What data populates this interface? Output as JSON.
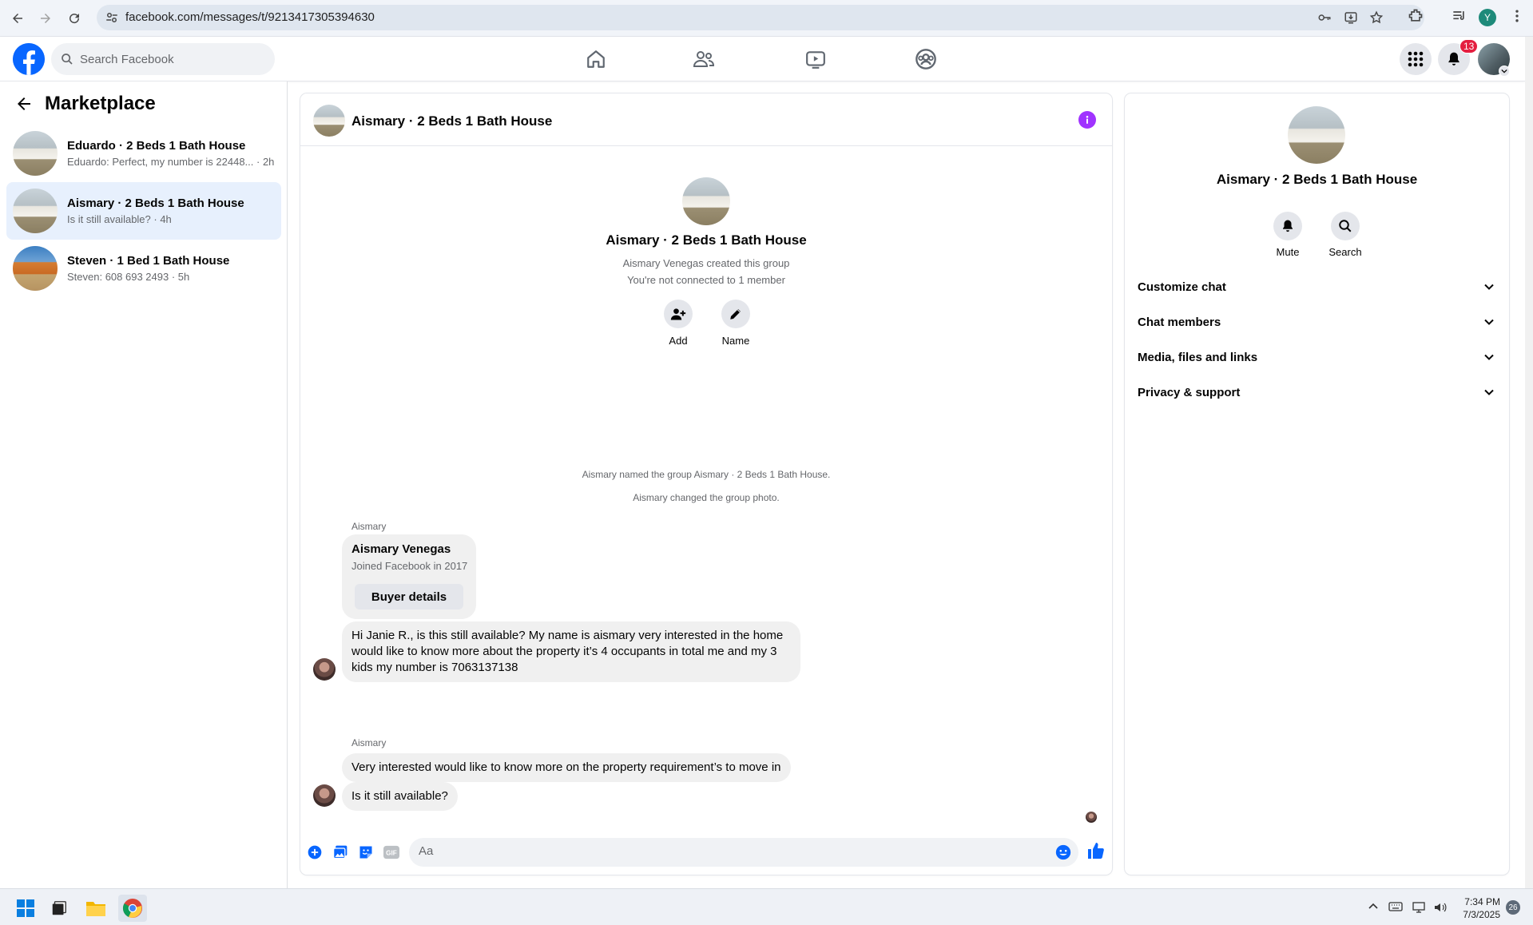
{
  "browser": {
    "url": "facebook.com/messages/t/9213417305394630",
    "profile_initial": "Y"
  },
  "fbnav": {
    "search_placeholder": "Search Facebook",
    "tabs": [
      "home-icon",
      "friends-icon",
      "video-icon",
      "groups-icon"
    ],
    "notification_count": "13"
  },
  "sidebar": {
    "title": "Marketplace",
    "conversations": [
      {
        "title": "Eduardo · 2 Beds 1 Bath House",
        "preview": "Eduardo: Perfect, my number is 22448... · 2h",
        "active": false
      },
      {
        "title": "Aismary · 2 Beds 1 Bath House",
        "preview": "Is it still available? · 4h",
        "active": true
      },
      {
        "title": "Steven · 1 Bed 1 Bath House",
        "preview": "Steven: 608 693 2493 · 5h",
        "active": false
      }
    ]
  },
  "chat": {
    "header_title": "Aismary · 2 Beds 1 Bath House",
    "group_name": "Aismary · 2 Beds 1 Bath House",
    "created_text": "Aismary Venegas created this group",
    "not_connected_text": "You're not connected to 1 member",
    "actions": {
      "add": "Add",
      "name": "Name"
    },
    "system_messages": [
      "Aismary named the group Aismary · 2 Beds 1 Bath House.",
      "Aismary changed the group photo."
    ],
    "sender_1": "Aismary",
    "card": {
      "name": "Aismary Venegas",
      "joined": "Joined Facebook in 2017",
      "button": "Buyer details"
    },
    "message_1": "Hi Janie R., is this still available? My name is aismary very interested in the home would like to know more about the property it’s 4 occupants in total me and my 3 kids my number is 7063137138",
    "sender_2": "Aismary",
    "message_2": "Very interested would like to know more on the property requirement’s to move in",
    "message_3": "Is it still available?",
    "composer_placeholder": "Aa"
  },
  "right_panel": {
    "name": "Aismary · 2 Beds 1 Bath House",
    "mute": "Mute",
    "search": "Search",
    "sections": [
      "Customize chat",
      "Chat members",
      "Media, files and links",
      "Privacy & support"
    ]
  },
  "taskbar": {
    "time": "7:34 PM",
    "date": "7/3/2025",
    "badge": "26"
  },
  "colors": {
    "fb_blue": "#0866ff",
    "info_purple": "#a033ff",
    "active_row": "#e7f0fd",
    "badge_red": "#e41e3f"
  }
}
